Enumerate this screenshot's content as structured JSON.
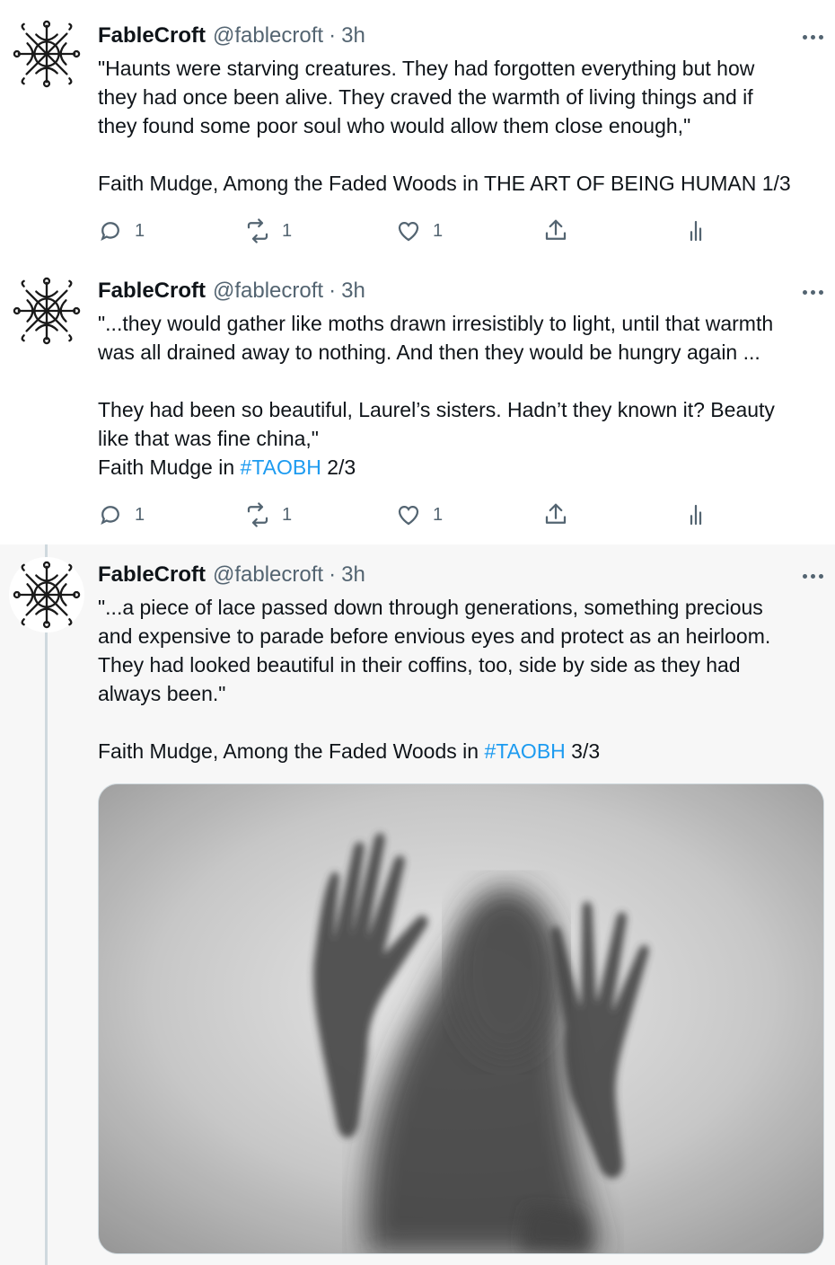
{
  "tweets": [
    {
      "author_name": "FableCroft",
      "handle": "@fablecroft",
      "separator": "·",
      "time": "3h",
      "body_lines": [
        "\"Haunts were starving creatures. They had forgotten everything but how",
        "they had once been alive. They craved the warmth of living things and if",
        "they found some poor soul who would allow them close enough,\"",
        "",
        "Faith Mudge, Among the Faded Woods in THE ART OF BEING HUMAN 1/3"
      ],
      "reply_count": "1",
      "retweet_count": "1",
      "like_count": "1"
    },
    {
      "author_name": "FableCroft",
      "handle": "@fablecroft",
      "separator": "·",
      "time": "3h",
      "body_lines": [
        "\"...they would gather like moths drawn irresistibly to light, until that warmth",
        "was all drained away to nothing. And then they would be hungry again ...",
        "",
        "They had been so beautiful, Laurel’s sisters. Hadn’t they known it? Beauty",
        "like that was fine china,\""
      ],
      "body_last_prefix": "Faith Mudge in ",
      "hashtag": "#TAOBH",
      "body_last_suffix": " 2/3",
      "reply_count": "1",
      "retweet_count": "1",
      "like_count": "1"
    },
    {
      "author_name": "FableCroft",
      "handle": "@fablecroft",
      "separator": "·",
      "time": "3h",
      "body_lines": [
        "\"...a piece of lace passed down through generations, something precious",
        "and expensive to parade before envious eyes and protect as an heirloom.",
        "They had looked beautiful in their coffins, too, side by side as they had",
        "always been.\"",
        ""
      ],
      "body_last_prefix": "Faith Mudge, Among the Faded Woods in ",
      "hashtag": "#TAOBH",
      "body_last_suffix": " 3/3"
    }
  ],
  "icons": {
    "reply": "reply-icon",
    "retweet": "retweet-icon",
    "like": "heart-icon",
    "share": "share-icon",
    "analytics": "analytics-icon",
    "more": "more-icon",
    "avatar": "celtic-knot-logo"
  },
  "colors": {
    "hashtag": "#1d9bf0",
    "secondary_text": "#536471",
    "thread_line": "#cfd9de",
    "highlight_background": "#f7f7f7"
  }
}
